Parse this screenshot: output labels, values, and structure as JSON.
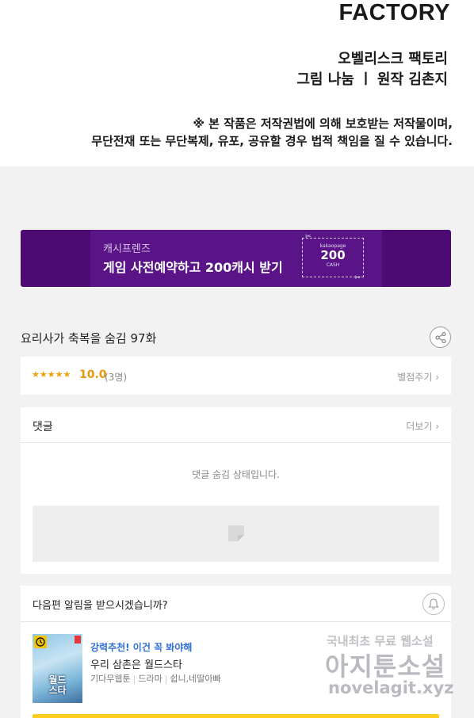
{
  "header": {
    "logo_text": "FACTORY",
    "credit_studio": "오벨리스크 팩토리",
    "credit_art": "그림 나눔 ㅣ 원작 김촌지",
    "copyright_line1": "※ 본 작품은 저작권법에 의해 보호받는 저작물이며,",
    "copyright_line2": "무단전재 또는 무단복제, 유포, 공유할 경우 법적 책임을 질 수 있습니다."
  },
  "banner": {
    "subtitle": "캐시프렌즈",
    "title": "게임 사전예약하고 200캐시 받기",
    "coupon_brand": "kakaopage",
    "coupon_amount": "200",
    "coupon_unit": "CASH",
    "accent_color": "#4d0a72"
  },
  "episode": {
    "title": "요리사가 축복을 숨김 97화",
    "share_icon": "share-icon"
  },
  "rating": {
    "stars": "★★★★★",
    "score": "10.0",
    "count": "(3명)",
    "rate_link": "별점주기 ›"
  },
  "comments": {
    "title": "댓글",
    "more_link": "더보기 ›",
    "hidden_message": "댓글 숨김 상태입니다."
  },
  "notify": {
    "question": "다음편 알림을 받으시겠습니까?",
    "bell_icon": "bell-icon"
  },
  "recommendation": {
    "tag": "강력추천! 이건 꼭 봐야해",
    "title": "우리 삼촌은 월드스타",
    "category": "기다무웹툰",
    "genre": "드라마",
    "author": "쉽니,네딸아빠",
    "thumb_title": "월드\n스타",
    "tag_color": "#2f6fd6",
    "bar_color": "#ffcd1e"
  },
  "watermark": {
    "line1": "국내최초 무료 웹소설",
    "line2": "아지툰소설",
    "line3": "novelagit.xyz"
  }
}
